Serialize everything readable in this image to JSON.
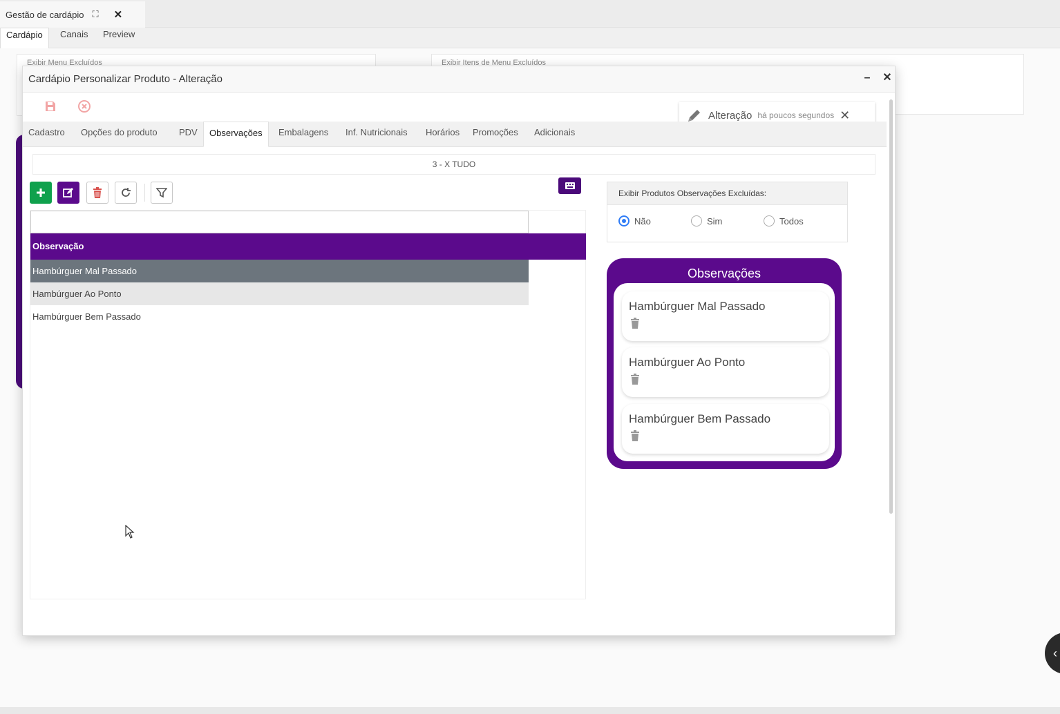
{
  "app": {
    "tab_title": "Gestão de cardápio",
    "subtabs": [
      "Cardápio",
      "Canais",
      "Preview"
    ],
    "bg_panels": [
      "Exibir Menu Excluídos",
      "Exibir Itens de Menu Excluídos"
    ]
  },
  "modal": {
    "title": "Cardápio Personalizar Produto - Alteração",
    "notification": {
      "title": "Alteração",
      "time": "há poucos segundos"
    },
    "tabs": [
      "Cadastro",
      "Opções do produto",
      "PDV",
      "Observações",
      "Embalagens",
      "Inf. Nutricionais",
      "Horários",
      "Promoções",
      "Adicionais"
    ],
    "active_tab": "Observações",
    "product": "3 - X TUDO",
    "grid": {
      "filter_value": "",
      "header": "Observação",
      "rows": [
        "Hambúrguer Mal Passado",
        "Hambúrguer Ao Ponto",
        "Hambúrguer Bem Passado"
      ],
      "selected_row": "Hambúrguer Mal Passado"
    },
    "excluded_filter": {
      "label": "Exibir Produtos Observações Excluídas:",
      "options": [
        "Não",
        "Sim",
        "Todos"
      ],
      "selected": "Não"
    },
    "obs_card": {
      "title": "Observações",
      "items": [
        "Hambúrguer Mal Passado",
        "Hambúrguer Ao Ponto",
        "Hambúrguer Bem Passado"
      ]
    }
  },
  "colors": {
    "accent_purple": "#5b0a8c",
    "add_green": "#0fa14d",
    "selected_row": "#6c757d",
    "radio_blue": "#2f7cf6",
    "delete_red": "#d9534f"
  },
  "icons": [
    "expand-icon",
    "close-icon",
    "save-icon",
    "cancel-icon",
    "pencil-icon",
    "plus-icon",
    "edit-icon",
    "trash-icon",
    "refresh-icon",
    "filter-icon",
    "keyboard-icon",
    "chevron-left-icon",
    "mouse-cursor-icon"
  ]
}
